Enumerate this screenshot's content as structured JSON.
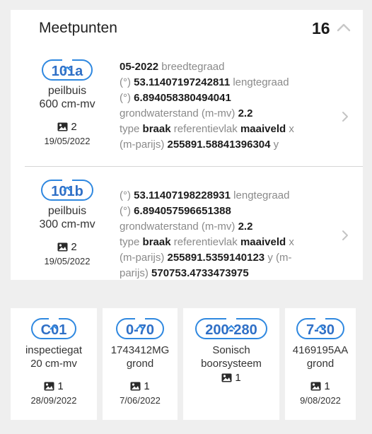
{
  "panel": {
    "title": "Meetpunten",
    "count": "16"
  },
  "rows": [
    {
      "code": "101a",
      "type": "peilbuis",
      "depth": "600 cm-mv",
      "photos": "2",
      "date": "19/05/2022",
      "details": {
        "line1_value": "05-2022",
        "line1_label": "breedtegraad",
        "line2_prefix": "(°)",
        "line2_value": "53.11407197242811",
        "line2_label": "lengtegraad",
        "line3_prefix": "(°)",
        "line3_value": "6.894058380494041",
        "line4_label": "grondwaterstand (m-mv)",
        "line4_value": "2.2",
        "line5_label": "type",
        "line5_value": "braak",
        "line5_label2": "referentievlak",
        "line5_value2": "maaiveld",
        "line5_suffix": "x",
        "line6_prefix": "(m-parijs)",
        "line6_value": "255891.58841396304",
        "line6_suffix": "y"
      }
    },
    {
      "code": "101b",
      "type": "peilbuis",
      "depth": "300 cm-mv",
      "photos": "2",
      "date": "19/05/2022",
      "details": {
        "line1_prefix": "(°)",
        "line1_value": "53.11407198228931",
        "line1_label": "lengtegraad",
        "line2_prefix": "(°)",
        "line2_value": "6.894057596651388",
        "line3_label": "grondwaterstand (m-mv)",
        "line3_value": "2.2",
        "line4_label": "type",
        "line4_value": "braak",
        "line4_label2": "referentievlak",
        "line4_value2": "maaiveld",
        "line4_suffix": "x",
        "line5_prefix": "(m-parijs)",
        "line5_value": "255891.5359140123",
        "line5_suffix": "y (m-",
        "line6_prefix": "parijs)",
        "line6_value": "570753.4733473975"
      }
    }
  ],
  "cards": [
    {
      "code": "C01",
      "line1": "inspectiegat",
      "line2": "20 cm-mv",
      "photos": "1",
      "date": "28/09/2022"
    },
    {
      "code": "0-70",
      "line1": "1743412MG",
      "line2": "grond",
      "photos": "1",
      "date": "7/06/2022"
    },
    {
      "code": "200-280",
      "line1": "Sonisch",
      "line2": "boorsysteem",
      "photos": "1",
      "date": ""
    },
    {
      "code": "7-30",
      "line1": "4169195AA",
      "line2": "grond",
      "photos": "1",
      "date": "9/08/2022"
    }
  ],
  "colors": {
    "accent": "#2f88e0",
    "background": "#efefef",
    "card": "#ffffff"
  }
}
